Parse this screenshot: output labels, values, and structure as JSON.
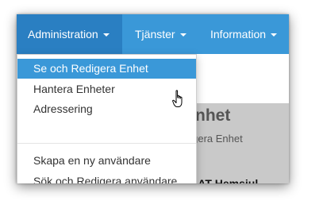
{
  "navbar": {
    "items": [
      {
        "label": "Administration"
      },
      {
        "label": "Tjänster"
      },
      {
        "label": "Information"
      }
    ]
  },
  "dropdown": {
    "items": [
      {
        "label": "Se och Redigera Enhet"
      },
      {
        "label": "Hantera Enheter"
      },
      {
        "label": "Adressering"
      },
      {
        "label": "Skapa en ny användare"
      },
      {
        "label": "Sök och Redigera användare"
      }
    ]
  },
  "content": {
    "heading": "Enhet",
    "subtitle": "digera Enhet",
    "status_line": "en : AT Hemsjul"
  },
  "colors": {
    "navbar": "#3a98d8",
    "navbar_active": "#2a7fc2",
    "highlight": "#3a98d8"
  },
  "cursor": {
    "icon": "hand-pointer-icon"
  }
}
